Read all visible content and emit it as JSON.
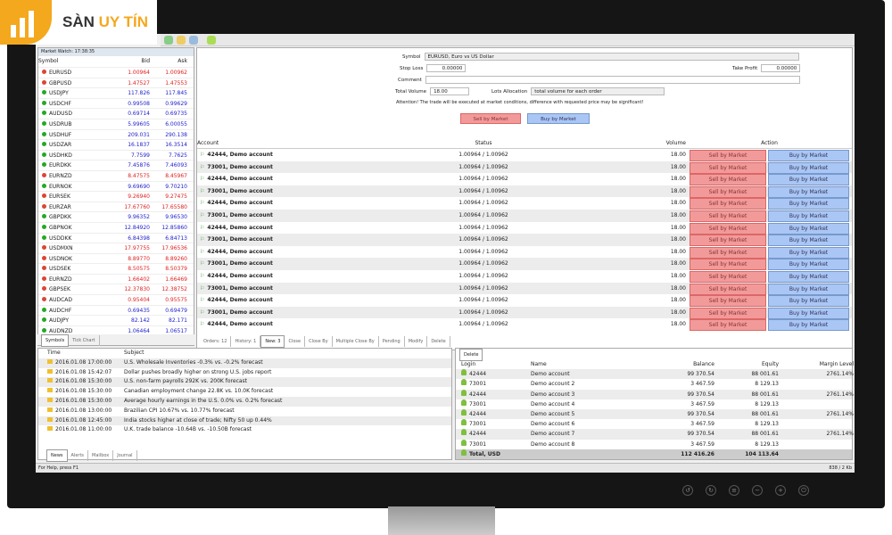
{
  "brand": {
    "logo_text": "SÀN UY TÍN",
    "accent": "#f4a81d"
  },
  "market_watch": {
    "title": "Market Watch: 17:38:35",
    "columns": [
      "Symbol",
      "Bid",
      "Ask"
    ],
    "rows": [
      [
        "EURUSD",
        "1.00964",
        "1.00962",
        "dn"
      ],
      [
        "GBPUSD",
        "1.47527",
        "1.47553",
        "dn"
      ],
      [
        "USDJPY",
        "117.826",
        "117.845",
        "up"
      ],
      [
        "USDCHF",
        "0.99508",
        "0.99629",
        "up"
      ],
      [
        "AUDUSD",
        "0.69714",
        "0.69735",
        "up"
      ],
      [
        "USDRUB",
        "5.99605",
        "6.00055",
        "up"
      ],
      [
        "USDHUF",
        "209.031",
        "290.138",
        "up"
      ],
      [
        "USDZAR",
        "16.1837",
        "16.3514",
        "up"
      ],
      [
        "USDHKD",
        "7.7599",
        "7.7625",
        "up"
      ],
      [
        "EURDKK",
        "7.45876",
        "7.46093",
        "up"
      ],
      [
        "EURNZD",
        "8.47575",
        "8.45967",
        "dn"
      ],
      [
        "EURNOK",
        "9.69690",
        "9.70210",
        "up"
      ],
      [
        "EURSEK",
        "9.26940",
        "9.27475",
        "dn"
      ],
      [
        "EURZAR",
        "17.67760",
        "17.65580",
        "dn"
      ],
      [
        "GBPDKK",
        "9.96352",
        "9.96530",
        "up"
      ],
      [
        "GBPNOK",
        "12.84920",
        "12.85860",
        "up"
      ],
      [
        "USDDKK",
        "6.84398",
        "6.84713",
        "up"
      ],
      [
        "USDMXN",
        "17.97755",
        "17.96536",
        "dn"
      ],
      [
        "USDNOK",
        "8.89770",
        "8.89260",
        "dn"
      ],
      [
        "USDSEK",
        "8.50575",
        "8.50379",
        "dn"
      ],
      [
        "EURNZD",
        "1.66402",
        "1.66469",
        "dn"
      ],
      [
        "GBPSEK",
        "12.37830",
        "12.38752",
        "dn"
      ],
      [
        "AUDCAD",
        "0.95404",
        "0.95575",
        "dn"
      ],
      [
        "AUDCHF",
        "0.69435",
        "0.69479",
        "up"
      ],
      [
        "AUDJPY",
        "82.142",
        "82.171",
        "up"
      ],
      [
        "AUDNZD",
        "1.06464",
        "1.06517",
        "up"
      ]
    ],
    "tabs": [
      "Symbols",
      "Tick Chart"
    ]
  },
  "order_form": {
    "symbol_label": "Symbol",
    "symbol_value": "EURUSD, Euro vs US Dollar",
    "sl_label": "Stop Loss",
    "sl_value": "0.00000",
    "tp_label": "Take Profit",
    "tp_value": "0.00000",
    "comment_label": "Comment",
    "comment_value": "",
    "volume_label": "Total Volume",
    "volume_value": "18.00",
    "alloc_label": "Lots Allocation",
    "alloc_value": "total volume for each order",
    "warning": "Attention! The trade will be executed at market conditions, difference with requested price may be significant!",
    "sell_label": "Sell by Market",
    "buy_label": "Buy by Market"
  },
  "orders_table": {
    "columns": [
      "Account",
      "Status",
      "Volume",
      "Action"
    ],
    "rows": [
      [
        "42444, Demo account",
        "1.00964 / 1.00962",
        "18.00"
      ],
      [
        "73001, Demo account",
        "1.00964 / 1.00962",
        "18.00"
      ],
      [
        "42444, Demo account",
        "1.00964 / 1.00962",
        "18.00"
      ],
      [
        "73001, Demo account",
        "1.00964 / 1.00962",
        "18.00"
      ],
      [
        "42444, Demo account",
        "1.00964 / 1.00962",
        "18.00"
      ],
      [
        "73001, Demo account",
        "1.00964 / 1.00962",
        "18.00"
      ],
      [
        "42444, Demo account",
        "1.00964 / 1.00962",
        "18.00"
      ],
      [
        "73001, Demo account",
        "1.00964 / 1.00962",
        "18.00"
      ],
      [
        "42444, Demo account",
        "1.00964 / 1.00962",
        "18.00"
      ],
      [
        "73001, Demo account",
        "1.00964 / 1.00962",
        "18.00"
      ],
      [
        "42444, Demo account",
        "1.00964 / 1.00962",
        "18.00"
      ],
      [
        "73001, Demo account",
        "1.00964 / 1.00962",
        "18.00"
      ],
      [
        "42444, Demo account",
        "1.00964 / 1.00962",
        "18.00"
      ],
      [
        "73001, Demo account",
        "1.00964 / 1.00962",
        "18.00"
      ],
      [
        "42444, Demo account",
        "1.00964 / 1.00962",
        "18.00"
      ]
    ],
    "sell_label": "Sell by Market",
    "buy_label": "Buy by Market"
  },
  "main_tabs": [
    "Orders: 12",
    "History: 1",
    "New: 3",
    "Close",
    "Close By",
    "Multiple Close By",
    "Pending",
    "Modify",
    "Delete"
  ],
  "news": {
    "columns": [
      "Time",
      "Subject"
    ],
    "rows": [
      [
        "2016.01.08 17:00:00",
        "U.S. Wholesale Inventories -0.3% vs. -0.2% forecast"
      ],
      [
        "2016.01.08 15:42:07",
        "Dollar pushes broadly higher on strong U.S. jobs report"
      ],
      [
        "2016.01.08 15:30:00",
        "U.S. non-farm payrolls 292K vs. 200K forecast"
      ],
      [
        "2016.01.08 15:30:00",
        "Canadian employment change 22.8K vs. 10.0K forecast"
      ],
      [
        "2016.01.08 15:30:00",
        "Average hourly earnings in the U.S. 0.0% vs. 0.2% forecast"
      ],
      [
        "2016.01.08 13:00:00",
        "Brazilian CPI 10.67% vs. 10.77% forecast"
      ],
      [
        "2016.01.08 12:45:00",
        "India stocks higher at close of trade; Nifty 50 up 0.44%"
      ],
      [
        "2016.01.08 11:00:00",
        "U.K. trade balance -10.64B vs. -10.50B forecast"
      ]
    ],
    "tabs": [
      "News",
      "Alerts",
      "Mailbox",
      "Journal"
    ]
  },
  "accounts": {
    "columns": [
      "Login",
      "Name",
      "Balance",
      "Equity",
      "Margin Level"
    ],
    "rows": [
      [
        "42444",
        "Demo account",
        "99 370.54",
        "88 001.61",
        "2761.14%"
      ],
      [
        "73001",
        "Demo account 2",
        "3 467.59",
        "8 129.13",
        ""
      ],
      [
        "42444",
        "Demo account 3",
        "99 370.54",
        "88 001.61",
        "2761.14%"
      ],
      [
        "73001",
        "Demo account 4",
        "3 467.59",
        "8 129.13",
        ""
      ],
      [
        "42444",
        "Demo account 5",
        "99 370.54",
        "88 001.61",
        "2761.14%"
      ],
      [
        "73001",
        "Demo account 6",
        "3 467.59",
        "8 129.13",
        ""
      ],
      [
        "42444",
        "Demo account 7",
        "99 370.54",
        "88 001.61",
        "2761.14%"
      ],
      [
        "73001",
        "Demo account 8",
        "3 467.59",
        "8 129.13",
        ""
      ]
    ],
    "total": [
      "Total, USD",
      "112 416.26",
      "104 113.64"
    ],
    "tabs": [
      "Delete"
    ]
  },
  "status": {
    "help": "For Help, press F1",
    "traffic": "838 / 2 Kb"
  }
}
